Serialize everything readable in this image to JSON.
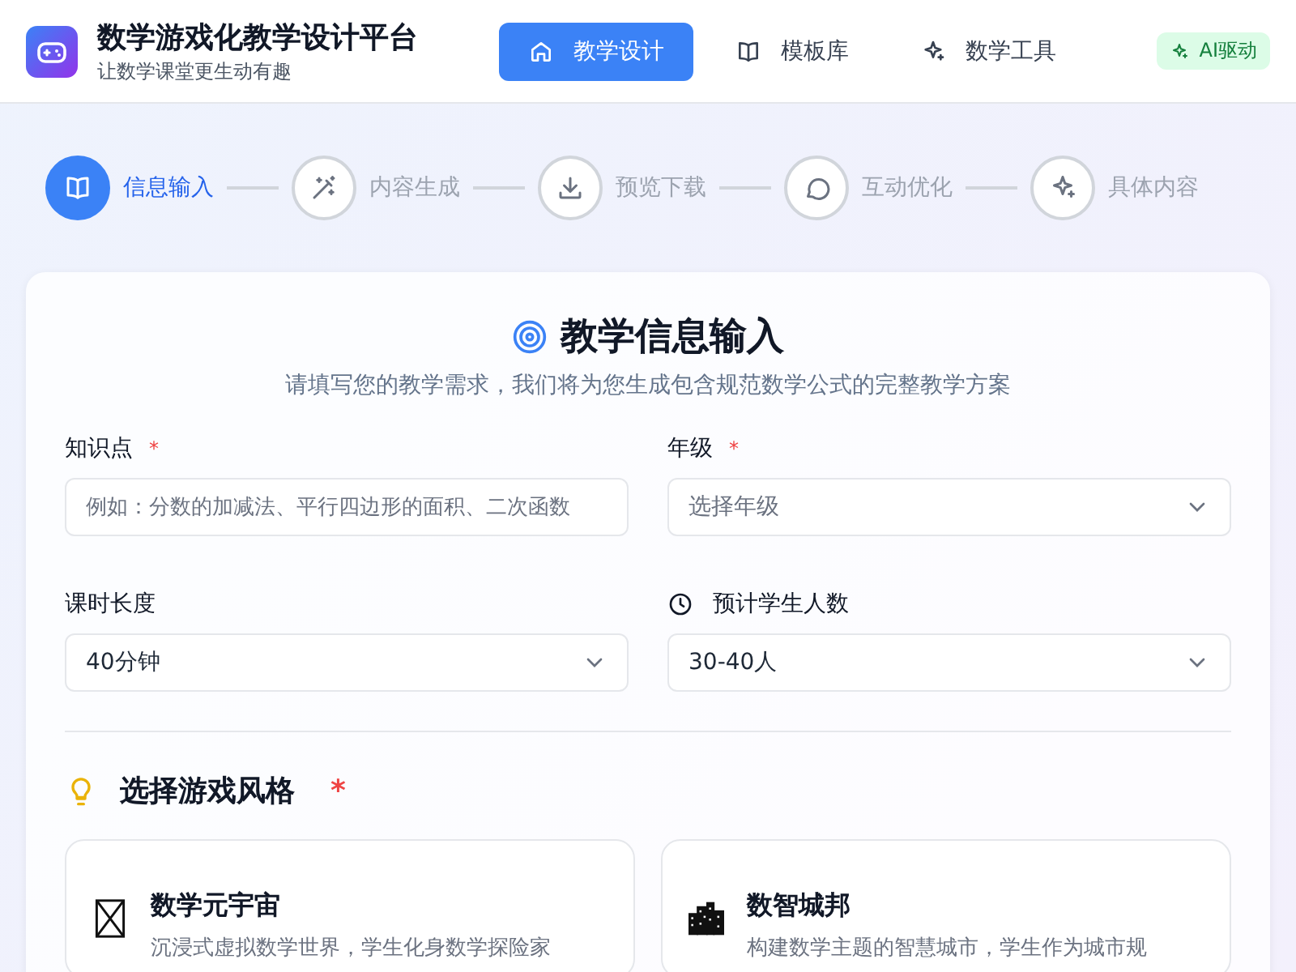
{
  "header": {
    "title": "数学游戏化教学设计平台",
    "subtitle": "让数学课堂更生动有趣",
    "badge": "AI驱动"
  },
  "nav": [
    {
      "label": "教学设计",
      "selected": true
    },
    {
      "label": "模板库",
      "selected": false
    },
    {
      "label": "数学工具",
      "selected": false
    }
  ],
  "steps": [
    {
      "label": "信息输入",
      "selected": true
    },
    {
      "label": "内容生成",
      "selected": false
    },
    {
      "label": "预览下载",
      "selected": false
    },
    {
      "label": "互动优化",
      "selected": false
    },
    {
      "label": "具体内容",
      "selected": false
    }
  ],
  "form": {
    "title": "教学信息输入",
    "subtitle": "请填写您的教学需求，我们将为您生成包含规范数学公式的完整教学方案",
    "fields": [
      {
        "kind": "input",
        "label": "知识点",
        "required_mark": "*",
        "placeholder": "例如：分数的加减法、平行四边形的面积、二次函数"
      },
      {
        "kind": "select",
        "label": "年级",
        "required_mark": "*",
        "placeholder": "选择年级"
      },
      {
        "kind": "select",
        "label": "课时长度",
        "value": "40分钟"
      },
      {
        "kind": "select",
        "label": "预计学生人数",
        "value": "30-40人"
      }
    ],
    "style_section": {
      "title": "选择游戏风格",
      "required_mark": "*",
      "options": [
        {
          "name": "数学元宇宙",
          "description": "沉浸式虚拟数学世界，学生化身数学探险家",
          "selected": false
        },
        {
          "name": "数智城邦",
          "description": "构建数学主题的智慧城市，学生作为城市规",
          "selected": false
        }
      ]
    }
  }
}
